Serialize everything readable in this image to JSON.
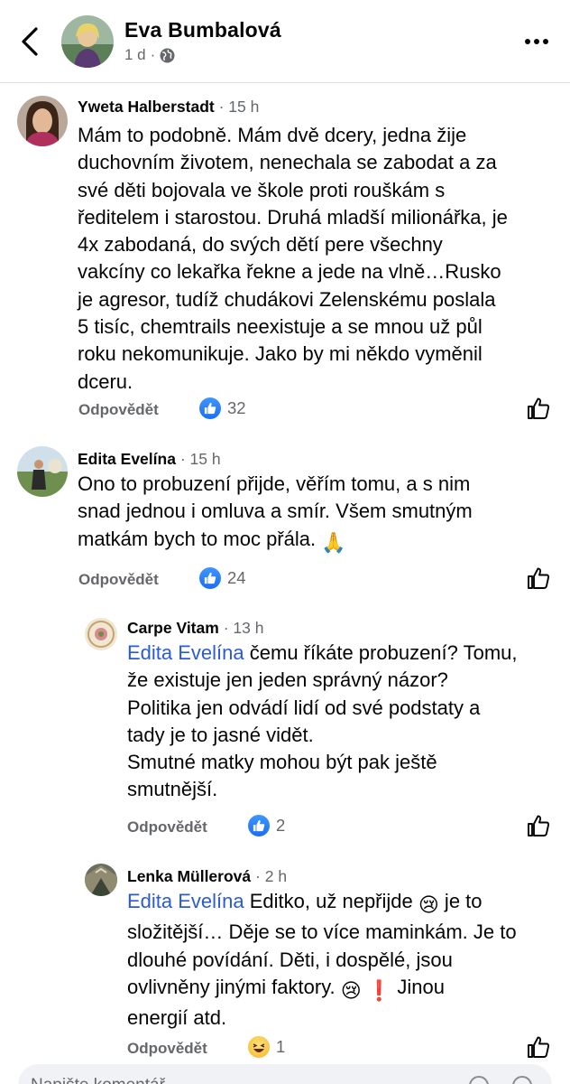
{
  "header": {
    "name": "Eva Bumbalová",
    "time": "1 d",
    "separator": "·"
  },
  "comments": [
    {
      "author": "Yweta Halberstadt",
      "time": "15 h",
      "lines": [
        "Mám to podobně. Mám dvě dcery, jedna žije",
        "duchovním životem, nenechala se zabodat a za",
        "své děti bojovala ve škole proti rouškám s",
        "ředitelem i starostou. Druhá mladší milionářka, je",
        "4x zabodaná, do svých dětí pere všechny",
        "vakcíny co lekařka řekne a jede  na vlně…Rusko",
        "je agresor, tudíž chudákovi Zelenskému poslala",
        "5 tisíc, chemtrails neexistuje a se mnou už půl",
        "roku nekomunikuje. Jako by mi někdo vyměnil",
        "dceru."
      ],
      "reply_label": "Odpovědět",
      "reactions": "32"
    },
    {
      "author": "Edita Evelína",
      "time": "15 h",
      "lines": [
        "Ono to probuzení přijde, věřím tomu, a s nim",
        "snad jednou i omluva a smír. Všem smutným",
        "matkám bych to moc přála."
      ],
      "emoji": "🙏",
      "reply_label": "Odpovědět",
      "reactions": "24"
    },
    {
      "author": "Carpe Vitam",
      "time": "13 h",
      "mention": "Edita Evelína",
      "first_line_rest": " čemu říkáte probuzení? Tomu,",
      "lines": [
        "že existuje jen jeden správný názor?",
        "Politika jen odvádí lidí od své podstaty  a",
        "tady je to jasné vidět.",
        "Smutné matky mohou být pak ještě",
        "smutnější."
      ],
      "reply_label": "Odpovědět",
      "reactions": "2"
    },
    {
      "author": "Lenka Müllerová",
      "time": "2 h",
      "mention": "Edita Evelína",
      "first_line_rest": " Editko, už nepřijde ",
      "first_line_emoji": "😢",
      "first_line_tail": " je to",
      "lines": [
        "složitější… Děje se to více maminkám. Je to",
        "dlouhé povídání. Děti, i dospělé, jsou"
      ],
      "line4_text": "ovlivněny jinými faktory. ",
      "line4_emoji1": "😢",
      "line4_emoji2": "❗",
      "line4_tail": "  Jinou",
      "line5": "energií atd.",
      "reply_label": "Odpovědět",
      "reactions": "1"
    }
  ],
  "composer": {
    "placeholder": "Napište komentář…"
  }
}
